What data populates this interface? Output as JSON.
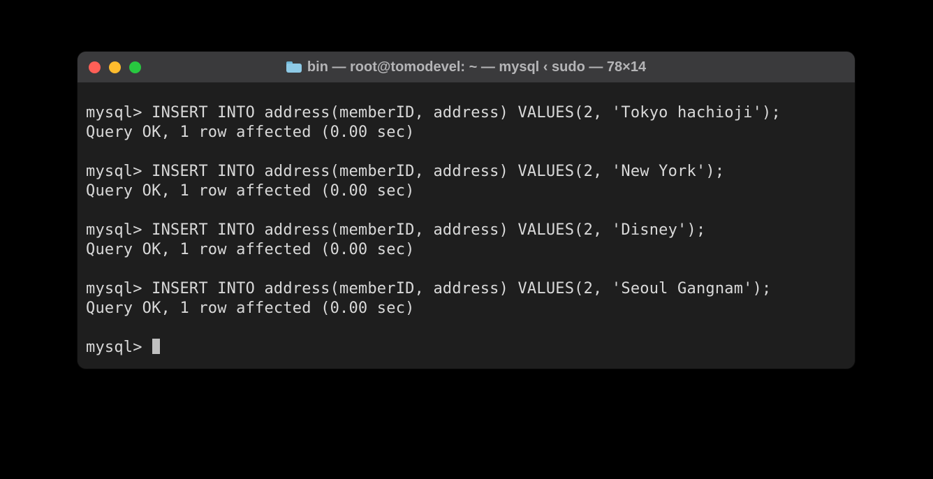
{
  "window": {
    "title": "bin — root@tomodevel: ~ — mysql ‹ sudo — 78×14"
  },
  "prompt": "mysql> ",
  "blocks": [
    {
      "command": "INSERT INTO address(memberID, address) VALUES(2, 'Tokyo hachioji');",
      "response": "Query OK, 1 row affected (0.00 sec)"
    },
    {
      "command": "INSERT INTO address(memberID, address) VALUES(2, 'New York');",
      "response": "Query OK, 1 row affected (0.00 sec)"
    },
    {
      "command": "INSERT INTO address(memberID, address) VALUES(2, 'Disney');",
      "response": "Query OK, 1 row affected (0.00 sec)"
    },
    {
      "command": "INSERT INTO address(memberID, address) VALUES(2, 'Seoul Gangnam');",
      "response": "Query OK, 1 row affected (0.00 sec)"
    }
  ]
}
